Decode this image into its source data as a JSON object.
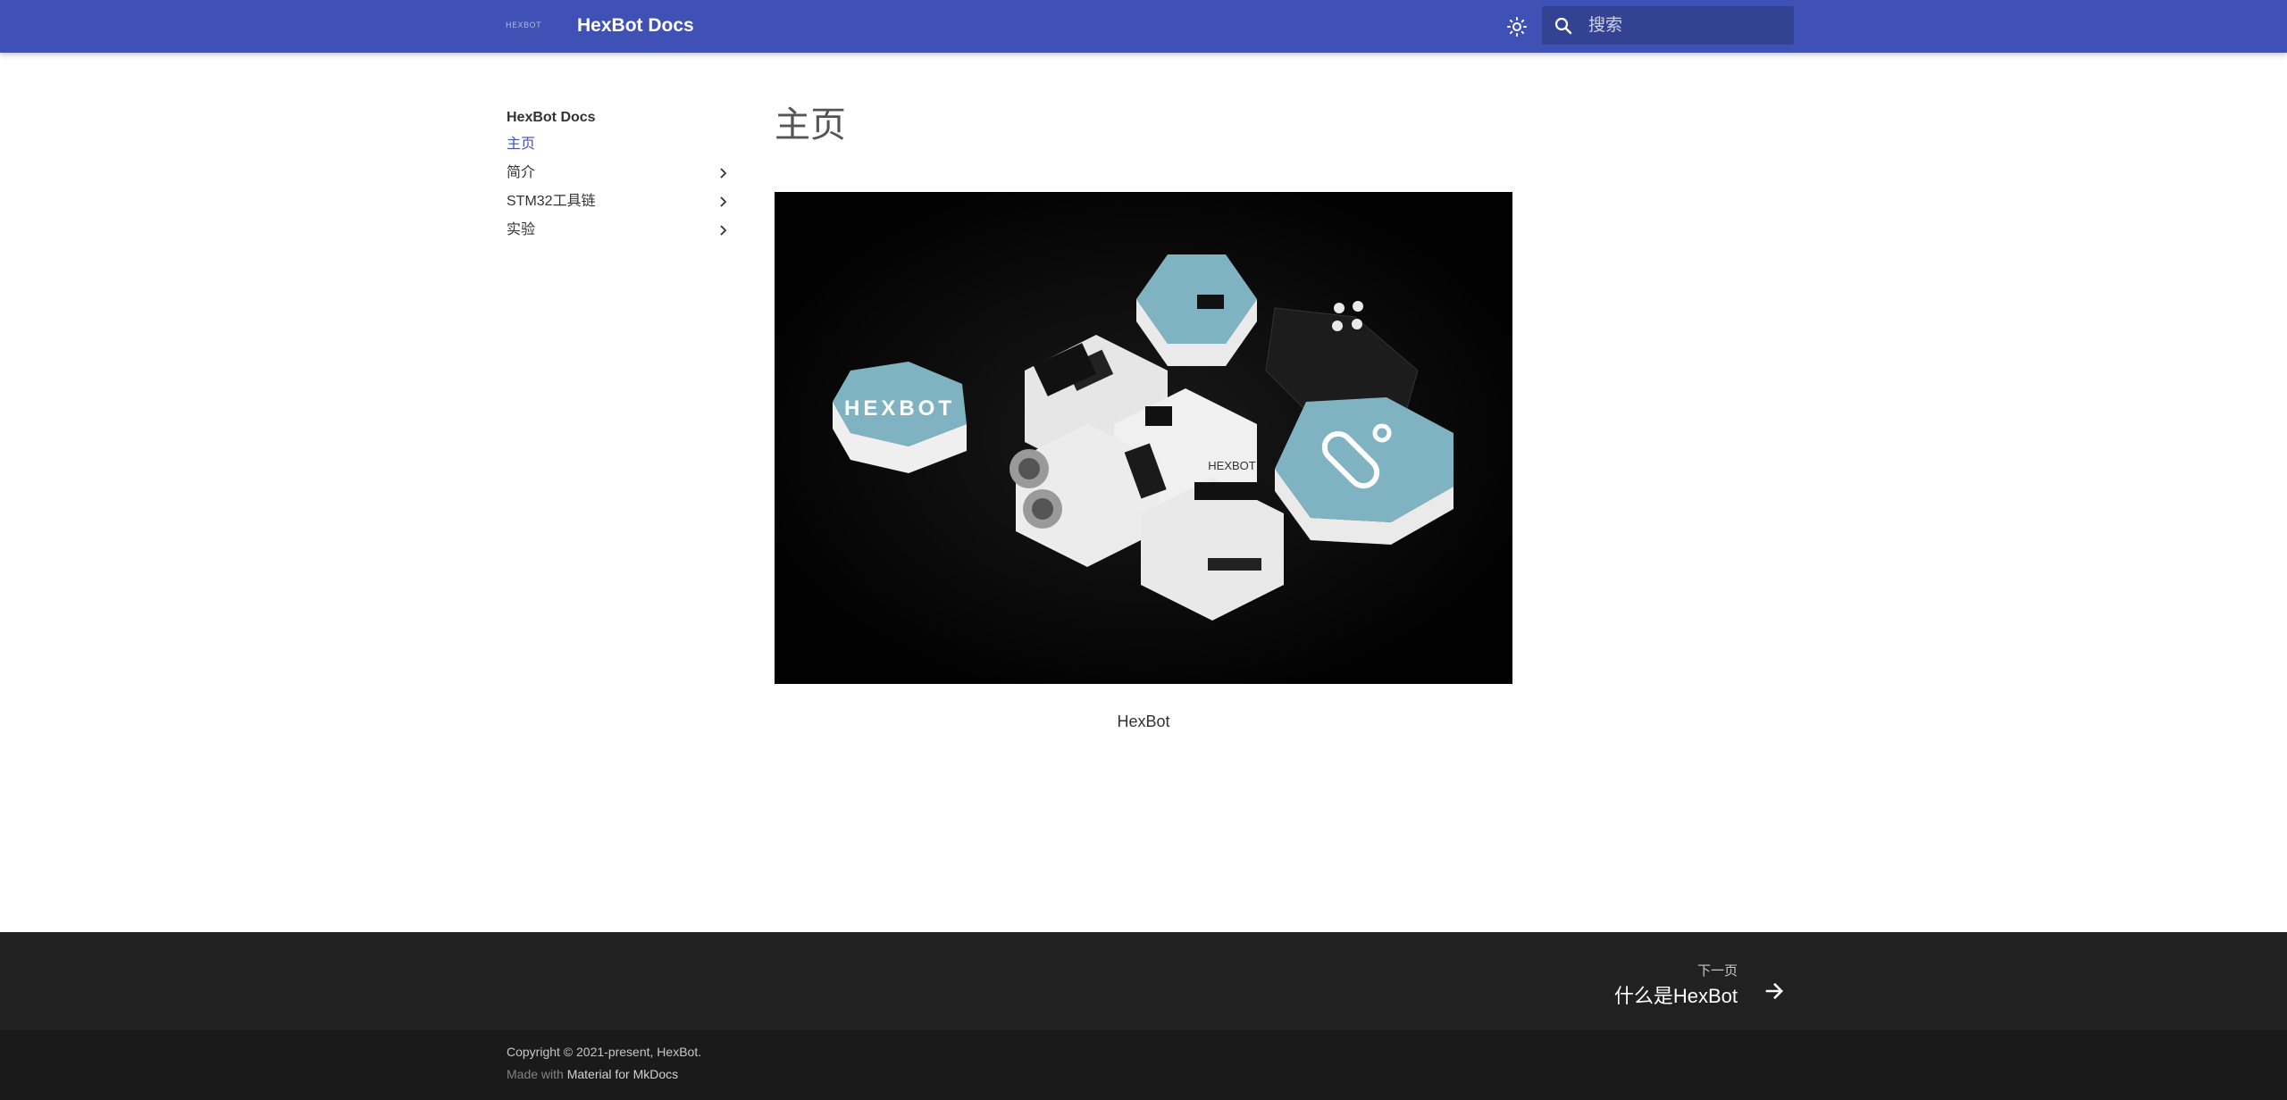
{
  "header": {
    "logo_text": "HEXBOT",
    "site_title": "HexBot Docs",
    "theme_toggle_icon": "brightness-icon",
    "search": {
      "placeholder": "搜索",
      "icon": "search-icon"
    }
  },
  "nav": {
    "title": "HexBot Docs",
    "items": [
      {
        "label": "主页",
        "active": true,
        "expandable": false
      },
      {
        "label": "简介",
        "active": false,
        "expandable": true
      },
      {
        "label": "STM32工具链",
        "active": false,
        "expandable": true
      },
      {
        "label": "实验",
        "active": false,
        "expandable": true
      }
    ]
  },
  "main": {
    "title": "主页",
    "hero_logo_text": "HEXBOT",
    "hero_board_text": "HEXBOT",
    "caption": "HexBot"
  },
  "footer": {
    "next": {
      "small_label": "下一页",
      "title": "什么是HexBot",
      "icon": "arrow-right-icon"
    },
    "copyright": "Copyright © 2021-present, HexBot.",
    "made_with_prefix": "Made with",
    "made_with_link": "Material for MkDocs"
  },
  "colors": {
    "primary": "#4051b5",
    "footer_dark": "#212121",
    "footer_darker": "#1a1a1a",
    "hex_blue": "#7fb3c2"
  }
}
